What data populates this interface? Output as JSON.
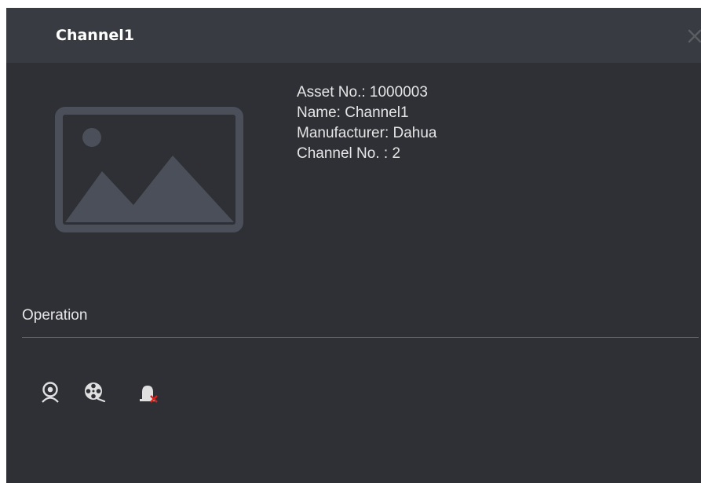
{
  "dialog": {
    "title": "Channel1",
    "close_icon": "close-icon"
  },
  "asset": {
    "thumbnail_icon": "image-placeholder-icon",
    "asset_no": "Asset No.: 1000003",
    "name": "Name: Channel1",
    "manufacturer": "Manufacturer: Dahua",
    "channel_no": "Channel No. : 2"
  },
  "operation": {
    "label": "Operation",
    "buttons": [
      {
        "icon": "camera-live-view-icon"
      },
      {
        "icon": "playback-reel-icon"
      },
      {
        "icon": "alarm-off-icon"
      }
    ]
  },
  "colors": {
    "panel_bg": "#2e3035",
    "titlebar_bg": "#383b41",
    "text": "#e6e6e6",
    "placeholder": "#4a4f59",
    "alarm_x": "#d9201c"
  }
}
